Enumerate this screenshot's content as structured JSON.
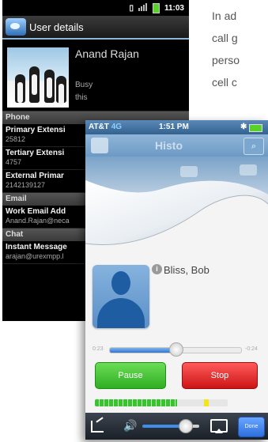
{
  "article": {
    "lines": [
      "In ad",
      "call g",
      "perso",
      "cell c"
    ]
  },
  "android": {
    "status": {
      "time": "11:03"
    },
    "title": "User details",
    "profile": {
      "name": "Anand Rajan",
      "status": "Busy",
      "status_note": "this"
    },
    "sections": {
      "phone": "Phone",
      "email": "Email",
      "chat": "Chat"
    },
    "phone_items": [
      {
        "label": "Primary Extensi",
        "value": "25812"
      },
      {
        "label": "Tertiary Extensi",
        "value": "4757"
      },
      {
        "label": "External Primar",
        "value": "2142139127"
      }
    ],
    "email_items": [
      {
        "label": "Work Email Add",
        "value": "Anand.Rajan@neca"
      }
    ],
    "chat_items": [
      {
        "label": "Instant Message",
        "value": "arajan@urexmpp.l"
      }
    ]
  },
  "iphone": {
    "status": {
      "carrier": "AT&T",
      "network": "4G",
      "time": "1:51 PM"
    },
    "nav_title": "Histo",
    "contact_name": "Bliss, Bob",
    "info_label": "i",
    "time_elapsed": "0:23",
    "time_remaining": "-0:24",
    "progress": 0.5,
    "pause_label": "Pause",
    "stop_label": "Stop",
    "level": 0.62,
    "level_marker": 0.82,
    "volume": 0.75,
    "done_label": "Done",
    "colors": {
      "pause": "#2fae22",
      "stop": "#cc1515",
      "accent": "#2d6fe0"
    }
  }
}
